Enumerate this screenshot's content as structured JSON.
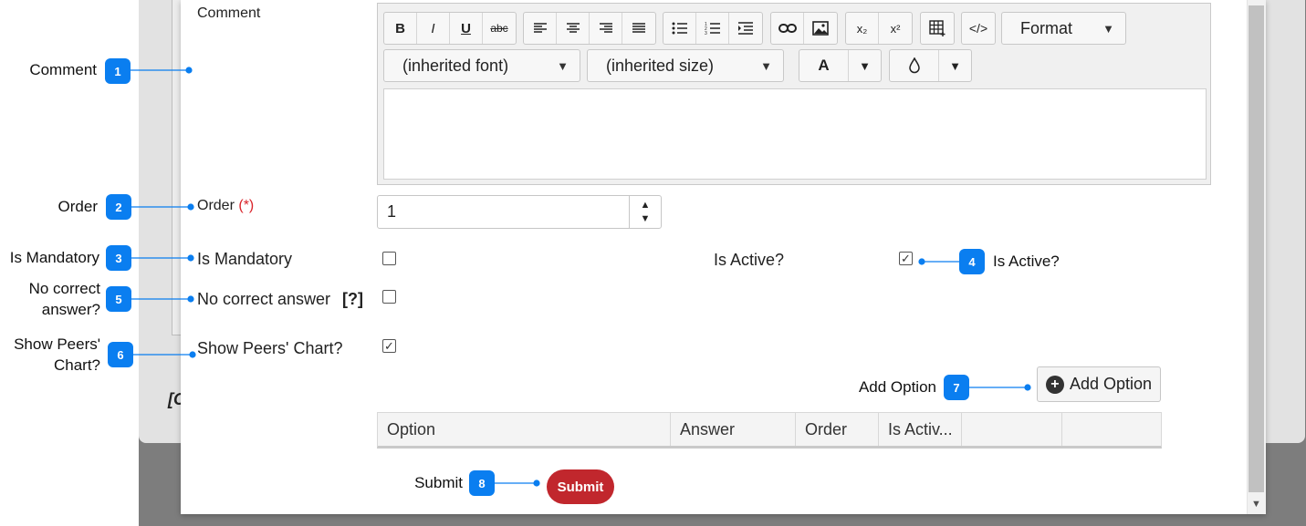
{
  "background": {
    "partial_text": "[C"
  },
  "form": {
    "comment_label": "Comment",
    "order_label": "Order",
    "order_required": "(*)",
    "order_value": "1",
    "is_mandatory_label": "Is Mandatory",
    "is_active_label": "Is Active?",
    "no_correct_answer_label": "No correct answer",
    "help_marker": "[?]",
    "show_peers_chart_label": "Show Peers' Chart?"
  },
  "editor": {
    "format_label": "Format",
    "font_label": "(inherited font)",
    "size_label": "(inherited size)",
    "text_color_glyph": "A",
    "buttons": {
      "bold": "B",
      "italic": "I",
      "underline": "U",
      "strikethrough": "abc",
      "subscript": "x₂",
      "superscript": "x²",
      "source": "</>"
    }
  },
  "checkboxes": {
    "is_mandatory": false,
    "is_active": true,
    "no_correct_answer": false,
    "show_peers_chart": true,
    "check_glyph": "✓"
  },
  "add_option_button": {
    "label": "Add Option",
    "icon": "plus-circle-icon"
  },
  "options_table": {
    "columns": [
      "Option",
      "Answer",
      "Order",
      "Is Activ...",
      "",
      ""
    ]
  },
  "submit_button": {
    "label": "Submit"
  },
  "callouts": [
    {
      "number": "1",
      "label": "Comment"
    },
    {
      "number": "2",
      "label": "Order"
    },
    {
      "number": "3",
      "label": "Is Mandatory"
    },
    {
      "number": "4",
      "label": "Is Active?"
    },
    {
      "number": "5",
      "label_line1": "No correct",
      "label_line2": "answer?"
    },
    {
      "number": "6",
      "label_line1": "Show Peers'",
      "label_line2": "Chart?"
    },
    {
      "number": "7",
      "label": "Add Option"
    },
    {
      "number": "8",
      "label": "Submit"
    }
  ],
  "colors": {
    "badge": "#0a7ef0",
    "submit": "#c1272d",
    "required": "#d9232a"
  }
}
